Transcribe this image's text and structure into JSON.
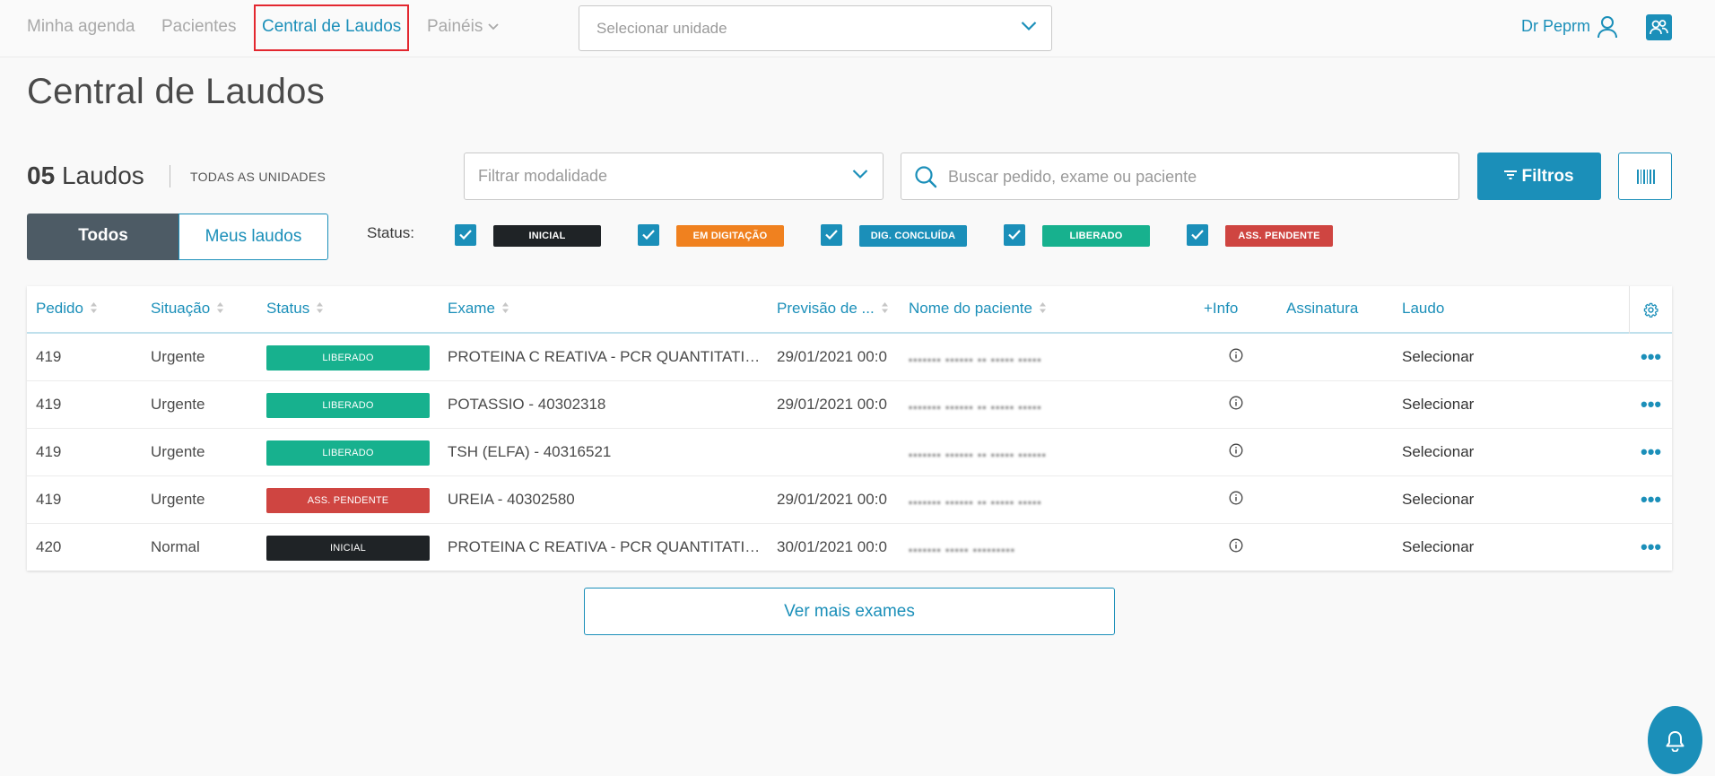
{
  "nav": {
    "items": [
      "Minha agenda",
      "Pacientes",
      "Central de Laudos",
      "Painéis"
    ],
    "active": "Central de Laudos",
    "unit_placeholder": "Selecionar unidade",
    "user_name": "Dr Peprm"
  },
  "page": {
    "title": "Central de Laudos"
  },
  "summary": {
    "count": "05",
    "count_label": "Laudos",
    "units_label": "TODAS AS UNIDADES"
  },
  "filters": {
    "modalidade_placeholder": "Filtrar modalidade",
    "search_placeholder": "Buscar pedido, exame ou paciente",
    "filtros_label": "Filtros"
  },
  "toggle": {
    "todos": "Todos",
    "meus": "Meus laudos"
  },
  "status_legend": {
    "label": "Status:",
    "items": [
      {
        "label": "INICIAL",
        "color": "#1f2326"
      },
      {
        "label": "EM DIGITAÇÃO",
        "color": "#f0811f"
      },
      {
        "label": "DIG. CONCLUÍDA",
        "color": "#1b8fb9"
      },
      {
        "label": "LIBERADO",
        "color": "#17b18e"
      },
      {
        "label": "ASS. PENDENTE",
        "color": "#cf4541"
      }
    ]
  },
  "table": {
    "columns": [
      "Pedido",
      "Situação",
      "Status",
      "Exame",
      "Previsão de ...",
      "Nome do paciente",
      "+Info",
      "Assinatura",
      "Laudo"
    ],
    "rows": [
      {
        "pedido": "419",
        "situacao": "Urgente",
        "status": "LIBERADO",
        "status_color": "#17b18e",
        "exame": "PROTEINA C REATIVA - PCR QUANTITATIV...",
        "previsao": "29/01/2021 00:0",
        "laudo": "Selecionar"
      },
      {
        "pedido": "419",
        "situacao": "Urgente",
        "status": "LIBERADO",
        "status_color": "#17b18e",
        "exame": "POTASSIO - 40302318",
        "previsao": "29/01/2021 00:0",
        "laudo": "Selecionar"
      },
      {
        "pedido": "419",
        "situacao": "Urgente",
        "status": "LIBERADO",
        "status_color": "#17b18e",
        "exame": "TSH (ELFA) - 40316521",
        "previsao": "",
        "laudo": "Selecionar"
      },
      {
        "pedido": "419",
        "situacao": "Urgente",
        "status": "ASS. PENDENTE",
        "status_color": "#cf4541",
        "exame": "UREIA - 40302580",
        "previsao": "29/01/2021 00:0",
        "laudo": "Selecionar"
      },
      {
        "pedido": "420",
        "situacao": "Normal",
        "status": "INICIAL",
        "status_color": "#1f2326",
        "exame": "PROTEINA C REATIVA - PCR QUANTITATIV...",
        "previsao": "30/01/2021 00:0",
        "laudo": "Selecionar"
      }
    ]
  },
  "footer": {
    "ver_mais": "Ver mais exames"
  },
  "colors": {
    "accent": "#1b8fb9",
    "highlight": "#e3272f"
  }
}
